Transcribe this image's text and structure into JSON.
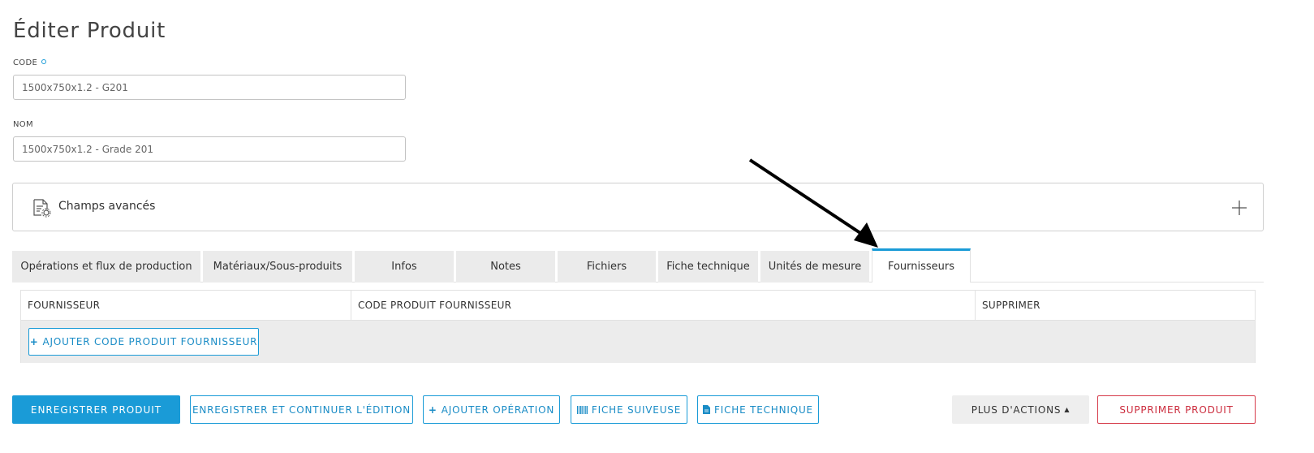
{
  "page": {
    "title": "Éditer Produit"
  },
  "form": {
    "code": {
      "label": "CODE",
      "value": "1500x750x1.2 - G201"
    },
    "nom": {
      "label": "NOM",
      "value": "1500x750x1.2 - Grade 201"
    }
  },
  "advanced": {
    "label": "Champs avancés"
  },
  "tabs": [
    {
      "label": "Opérations et flux de production"
    },
    {
      "label": "Matériaux/Sous-produits"
    },
    {
      "label": "Infos"
    },
    {
      "label": "Notes"
    },
    {
      "label": "Fichiers"
    },
    {
      "label": "Fiche technique"
    },
    {
      "label": "Unités de mesure"
    },
    {
      "label": "Fournisseurs",
      "active": true
    }
  ],
  "suppliers_table": {
    "columns": [
      "FOURNISSEUR",
      "CODE PRODUIT FOURNISSEUR",
      "SUPPRIMER"
    ],
    "add_button": "AJOUTER CODE PRODUIT FOURNISSEUR"
  },
  "actions": {
    "save": "ENREGISTRER PRODUIT",
    "save_continue": "ENREGISTRER ET CONTINUER L'ÉDITION",
    "add_operation": "AJOUTER OPÉRATION",
    "fiche_suiveuse": "FICHE SUIVEUSE",
    "fiche_technique": "FICHE TECHNIQUE",
    "more_actions": "PLUS D'ACTIONS",
    "delete": "SUPPRIMER PRODUIT"
  },
  "colors": {
    "accent": "#1a9bd7",
    "danger": "#cc2d3e",
    "tab_bg": "#ebebeb",
    "table_body_bg": "#ececec"
  }
}
